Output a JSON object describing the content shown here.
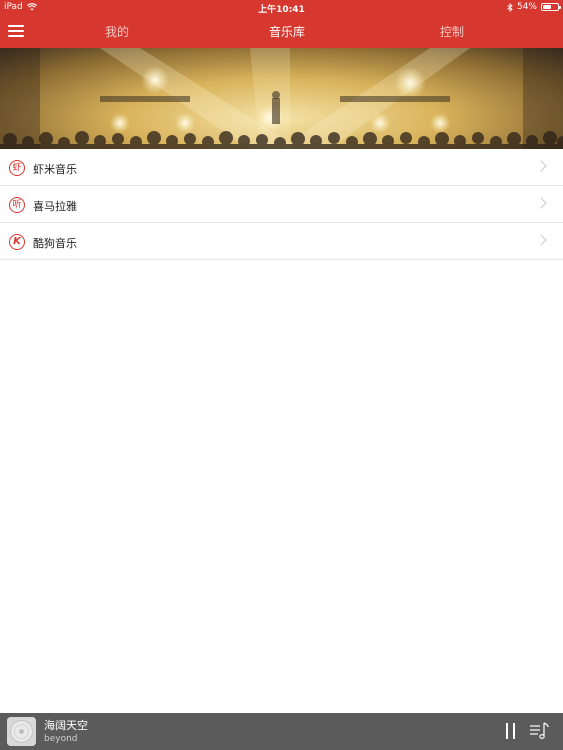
{
  "status_bar": {
    "device": "iPad",
    "time": "上午10:41",
    "battery_text": "54%",
    "battery_level": 0.54
  },
  "nav": {
    "tabs": [
      {
        "label": "我的",
        "active": false
      },
      {
        "label": "音乐库",
        "active": true
      },
      {
        "label": "控制",
        "active": false
      }
    ]
  },
  "sources": [
    {
      "icon": "虾",
      "label": "虾米音乐"
    },
    {
      "icon": "听",
      "label": "喜马拉雅"
    },
    {
      "icon": "K",
      "label": "酷狗音乐"
    }
  ],
  "player": {
    "title": "海阔天空",
    "artist": "beyond"
  },
  "colors": {
    "accent": "#d6372f",
    "player_bg": "#5b5b5b"
  }
}
